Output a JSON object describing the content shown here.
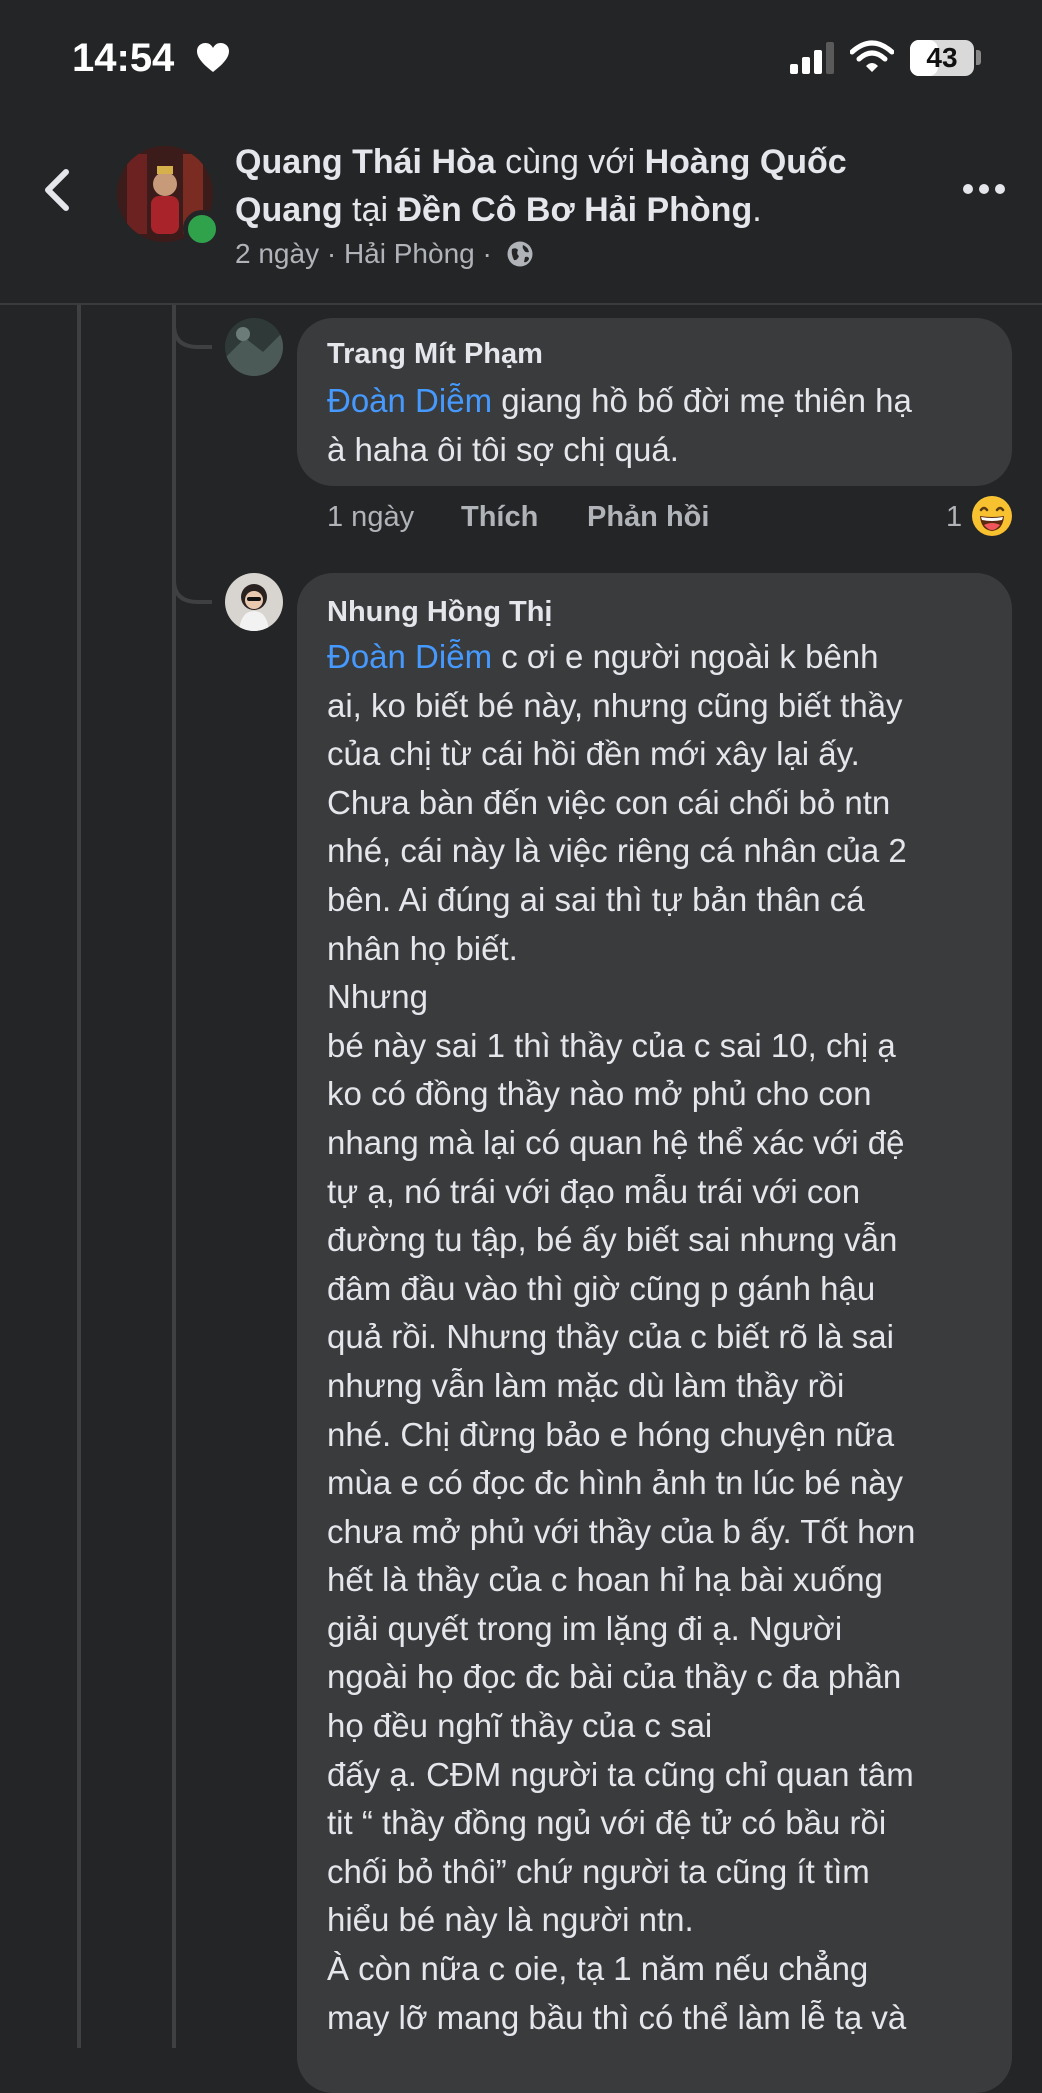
{
  "status_bar": {
    "time": "14:54",
    "battery": "43",
    "battery_level": 43
  },
  "post_header": {
    "author": "Quang Thái Hòa",
    "with_text": " cùng với ",
    "tagged": "Hoàng Quốc Quang",
    "at_text": " tại ",
    "location": "Đền Cô Bơ Hải Phòng",
    "end_text": ".",
    "meta": "2 ngày · Hải Phòng · "
  },
  "comments": [
    {
      "author": "Trang Mít Phạm",
      "mention": "Đoàn Diễm",
      "text": " giang hồ bố đời mẹ thiên hạ\nà haha ôi tôi sợ chị quá.",
      "time": "1 ngày",
      "like_label": "Thích",
      "reply_label": "Phản hồi",
      "reaction_count": "1"
    },
    {
      "author": "Nhung Hồng Thị",
      "mention": "Đoàn Diễm",
      "text": " c ơi e người ngoài k bênh\nai, ko biết bé này, nhưng cũng biết thầy\ncủa chị từ cái hồi đền mới xây lại ấy.\nChưa bàn đến việc con cái chối bỏ ntn\nnhé, cái này là việc riêng cá nhân của 2\nbên. Ai đúng ai sai thì tự bản thân cá\nnhân họ biết.\nNhưng\nbé này sai 1 thì thầy của c sai 10, chị ạ\nko có đồng thầy nào mở phủ cho con\nnhang mà lại có quan hệ thể xác với đệ\ntự ạ, nó trái với đạo mẫu trái với con\nđường tu tập, bé ấy biết sai nhưng vẫn\nđâm đầu vào thì giờ cũng p gánh hậu\nquả rồi. Nhưng thầy của c biết rõ là sai\nnhưng vẫn làm mặc dù làm thầy rồi\nnhé. Chị đừng bảo e hóng chuyện nữa\nmùa e có đọc đc hình ảnh tn lúc bé này\nchưa mở phủ với thầy của b ấy. Tốt hơn\nhết là thầy của c hoan hỉ hạ bài xuống\ngiải quyết trong im lặng đi ạ. Người\nngoài họ đọc đc bài của thầy c đa phần\nhọ đều nghĩ thầy của c sai\nđấy ạ. CĐM người ta cũng chỉ quan tâm\ntit “ thầy đồng ngủ với đệ tử có bầu rồi\nchối bỏ thôi” chứ người ta cũng ít tìm\nhiểu bé này là người ntn.\nÀ còn nữa c oie, tạ 1 năm nếu chẳng\nmay lỡ mang bầu thì có thể làm lễ tạ và"
    }
  ],
  "colors": {
    "background": "#242526",
    "bubble": "#3a3b3c",
    "mention": "#4599ff",
    "online": "#31a24c"
  },
  "icons": [
    "heart-icon",
    "signal-icon",
    "wifi-icon",
    "battery-icon",
    "back-arrow-icon",
    "globe-icon",
    "more-icon",
    "laughing-emoji-icon"
  ]
}
